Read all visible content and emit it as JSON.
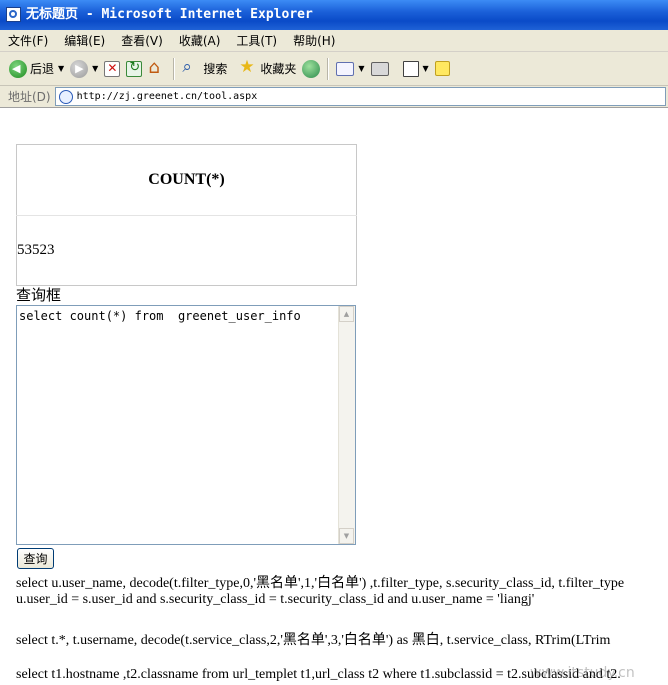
{
  "window": {
    "title": "无标题页 - Microsoft Internet Explorer"
  },
  "menu": {
    "items": [
      "文件(F)",
      "编辑(E)",
      "查看(V)",
      "收藏(A)",
      "工具(T)",
      "帮助(H)"
    ]
  },
  "toolbar": {
    "back_label": "后退",
    "search_label": "搜索",
    "favorites_label": "收藏夹"
  },
  "address": {
    "label": "地址(D)",
    "url": "http://zj.greenet.cn/tool.aspx"
  },
  "result": {
    "column_header": "COUNT(*)",
    "value": "53523"
  },
  "query": {
    "label": "查询框",
    "text": "select count(*) from  greenet_user_info",
    "submit_label": "查询"
  },
  "sql_examples": {
    "line1a": "select u.user_name, decode(t.filter_type,0,'黑名单',1,'白名单') ,t.filter_type, s.security_class_id, t.filter_type",
    "line1b": "u.user_id = s.user_id and s.security_class_id = t.security_class_id and u.user_name = 'liangj'",
    "line2": "select t.*, t.username, decode(t.service_class,2,'黑名单',3,'白名单') as 黑白, t.service_class, RTrim(LTrim",
    "line3": "select t1.hostname ,t2.classname from url_templet t1,url_class t2 where t1.subclassid = t2.subclassid and t2."
  },
  "watermark": "www.itstudy.cn"
}
